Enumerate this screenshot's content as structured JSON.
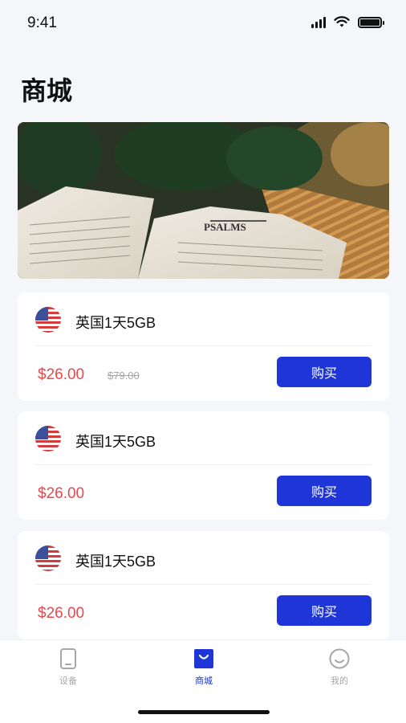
{
  "status_bar": {
    "time": "9:41"
  },
  "page": {
    "title": "商城"
  },
  "products": [
    {
      "name": "英国1天5GB",
      "price": "$26.00",
      "original_price": "$79.00",
      "buy_label": "购买"
    },
    {
      "name": "英国1天5GB",
      "price": "$26.00",
      "original_price": "",
      "buy_label": "购买"
    },
    {
      "name": "英国1天5GB",
      "price": "$26.00",
      "original_price": "",
      "buy_label": "购买"
    }
  ],
  "tabbar": {
    "tabs": [
      {
        "label": "设备",
        "icon": "phone-icon",
        "active": false
      },
      {
        "label": "商城",
        "icon": "shop-bag-icon",
        "active": true
      },
      {
        "label": "我的",
        "icon": "smiley-icon",
        "active": false
      }
    ]
  },
  "colors": {
    "accent": "#1e36d8",
    "price": "#e5484d",
    "background": "#f4f6f9"
  }
}
